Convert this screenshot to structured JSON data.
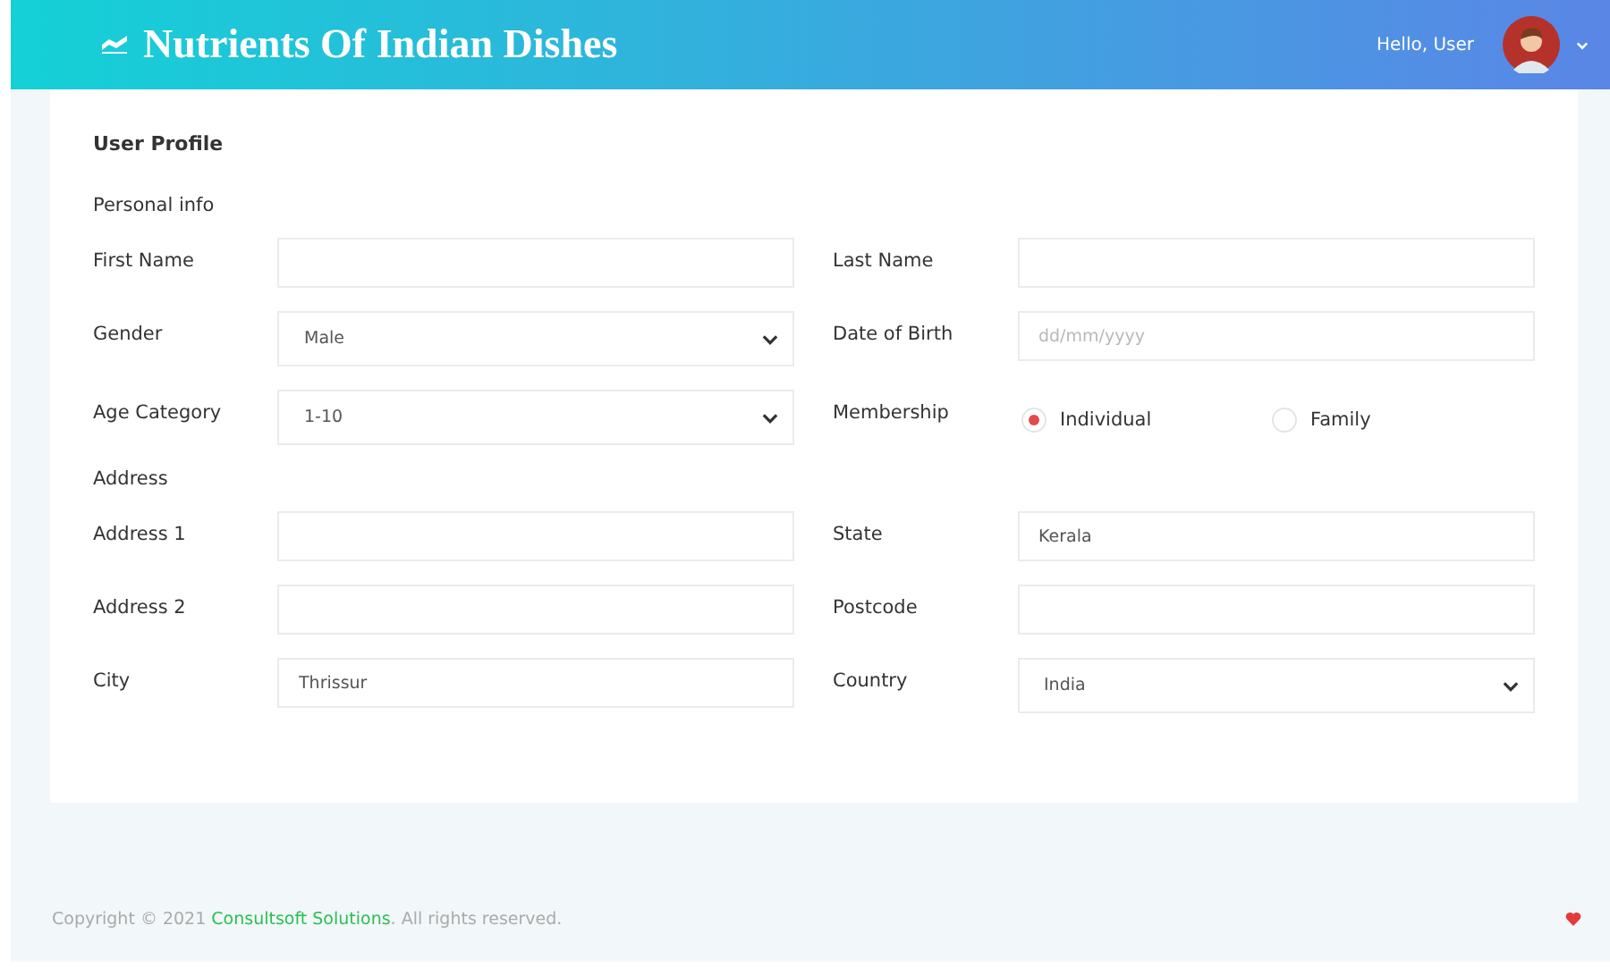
{
  "header": {
    "title": "Nutrients Of Indian Dishes",
    "greeting": "Hello, User"
  },
  "profile": {
    "title": "User Profile",
    "sections": [
      {
        "heading": "Personal info",
        "rows": [
          [
            {
              "label": "First Name",
              "kind": "text"
            },
            {
              "label": "Last Name",
              "kind": "text"
            }
          ],
          [
            {
              "label": "Gender",
              "kind": "select",
              "value": "Male"
            },
            {
              "label": "Date of Birth",
              "kind": "date",
              "placeholder": "dd/mm/yyyy"
            }
          ],
          [
            {
              "label": "Age Category",
              "kind": "select",
              "value": "1-10"
            },
            {
              "label": "Membership",
              "kind": "radio",
              "options": [
                {
                  "label": "Individual",
                  "selected": true
                },
                {
                  "label": "Family",
                  "selected": false
                }
              ]
            }
          ]
        ]
      },
      {
        "heading": "Address",
        "rows": [
          [
            {
              "label": "Address 1",
              "kind": "text"
            },
            {
              "label": "State",
              "kind": "text",
              "value": "Kerala"
            }
          ],
          [
            {
              "label": "Address 2",
              "kind": "text"
            },
            {
              "label": "Postcode",
              "kind": "text"
            }
          ],
          [
            {
              "label": "City",
              "kind": "text",
              "value": "Thrissur"
            },
            {
              "label": "Country",
              "kind": "select",
              "value": "India"
            }
          ]
        ]
      }
    ]
  },
  "footer": {
    "prefix": "Copyright © 2021 ",
    "link": "Consultsoft Solutions",
    "suffix": ". All rights reserved."
  }
}
